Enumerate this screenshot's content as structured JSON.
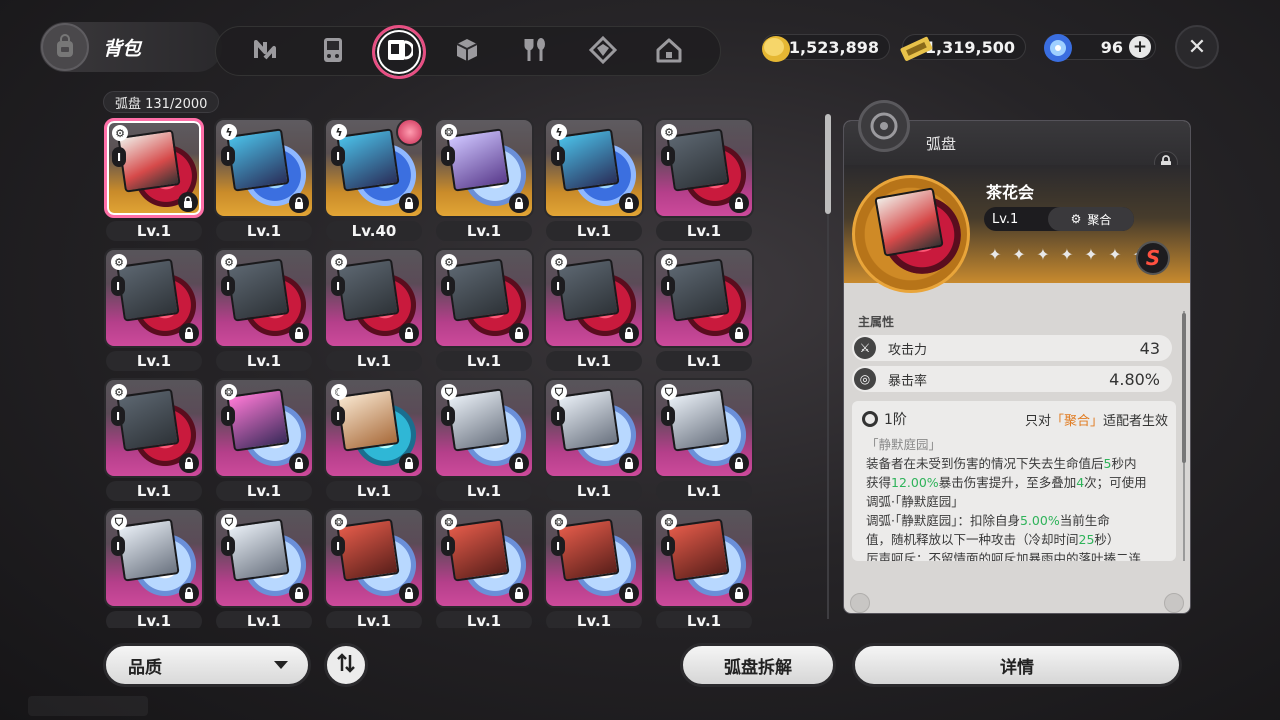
{
  "header": {
    "bag_label": "背包",
    "tabs": [
      {
        "name": "tab-agents",
        "icon": "n-logo-icon"
      },
      {
        "name": "tab-devices",
        "icon": "gameboy-icon"
      },
      {
        "name": "tab-discs",
        "icon": "disc-sleeve-icon",
        "active": true
      },
      {
        "name": "tab-materials",
        "icon": "cube-icon"
      },
      {
        "name": "tab-consumables",
        "icon": "fork-spoon-icon"
      },
      {
        "name": "tab-upgrade",
        "icon": "crystal-icon"
      },
      {
        "name": "tab-home",
        "icon": "house-icon"
      }
    ],
    "currencies": [
      {
        "icon": "gold-coin-icon",
        "value": "1,523,898"
      },
      {
        "icon": "ticket-icon",
        "value": "1,319,500"
      },
      {
        "icon": "energy-orb-icon",
        "value": "96"
      }
    ]
  },
  "inventory": {
    "count_label": "弧盘  131/2000",
    "items": [
      {
        "lv": "Lv.1",
        "type": "gear",
        "rim": "gold",
        "disc": "red",
        "sleeve": "art1",
        "selected": true
      },
      {
        "lv": "Lv.1",
        "type": "bolt",
        "rim": "gold",
        "disc": "blue",
        "sleeve": "art2"
      },
      {
        "lv": "Lv.40",
        "type": "bolt",
        "rim": "gold",
        "disc": "blue",
        "sleeve": "art2",
        "equipped": true
      },
      {
        "lv": "Lv.1",
        "type": "swirl",
        "rim": "gold",
        "disc": "white",
        "sleeve": "art3"
      },
      {
        "lv": "Lv.1",
        "type": "bolt",
        "rim": "gold",
        "disc": "blue",
        "sleeve": "art2"
      },
      {
        "lv": "Lv.1",
        "type": "gear",
        "rim": "pink",
        "disc": "red",
        "sleeve": "dark"
      },
      {
        "lv": "Lv.1",
        "type": "gear",
        "rim": "pink",
        "disc": "red",
        "sleeve": "dark"
      },
      {
        "lv": "Lv.1",
        "type": "gear",
        "rim": "pink",
        "disc": "red",
        "sleeve": "dark"
      },
      {
        "lv": "Lv.1",
        "type": "gear",
        "rim": "pink",
        "disc": "red",
        "sleeve": "dark"
      },
      {
        "lv": "Lv.1",
        "type": "gear",
        "rim": "pink",
        "disc": "red",
        "sleeve": "dark"
      },
      {
        "lv": "Lv.1",
        "type": "gear",
        "rim": "pink",
        "disc": "red",
        "sleeve": "dark"
      },
      {
        "lv": "Lv.1",
        "type": "gear",
        "rim": "pink",
        "disc": "red",
        "sleeve": "dark"
      },
      {
        "lv": "Lv.1",
        "type": "gear",
        "rim": "pink",
        "disc": "red",
        "sleeve": "dark"
      },
      {
        "lv": "Lv.1",
        "type": "swirl",
        "rim": "pink",
        "disc": "white",
        "sleeve": "art7"
      },
      {
        "lv": "Lv.1",
        "type": "moon",
        "rim": "pink",
        "disc": "cyan",
        "sleeve": "art4"
      },
      {
        "lv": "Lv.1",
        "type": "shield",
        "rim": "pink",
        "disc": "white",
        "sleeve": "art5"
      },
      {
        "lv": "Lv.1",
        "type": "shield",
        "rim": "pink",
        "disc": "white",
        "sleeve": "art5"
      },
      {
        "lv": "Lv.1",
        "type": "shield",
        "rim": "pink",
        "disc": "white",
        "sleeve": "art5"
      },
      {
        "lv": "Lv.1",
        "type": "shield",
        "rim": "pink",
        "disc": "white",
        "sleeve": "art5"
      },
      {
        "lv": "Lv.1",
        "type": "shield",
        "rim": "pink",
        "disc": "white",
        "sleeve": "art5"
      },
      {
        "lv": "Lv.1",
        "type": "swirl",
        "rim": "pink",
        "disc": "white",
        "sleeve": "art6"
      },
      {
        "lv": "Lv.1",
        "type": "swirl",
        "rim": "pink",
        "disc": "white",
        "sleeve": "art6"
      },
      {
        "lv": "Lv.1",
        "type": "swirl",
        "rim": "pink",
        "disc": "white",
        "sleeve": "art6"
      },
      {
        "lv": "Lv.1",
        "type": "swirl",
        "rim": "pink",
        "disc": "white",
        "sleeve": "art6"
      }
    ]
  },
  "controls": {
    "filter_label": "品质",
    "dismantle_label": "弧盘拆解",
    "details_label": "详情"
  },
  "detail": {
    "header_title": "弧盘",
    "disc_name": "茶花会",
    "level": "Lv.1",
    "tag": "聚合",
    "rank": "S",
    "stars": 7,
    "main_attr_label": "主属性",
    "attrs": [
      {
        "label": "攻击力",
        "value": "43",
        "icon": "attack-icon"
      },
      {
        "label": "暴击率",
        "value": "4.80%",
        "icon": "crit-icon"
      }
    ],
    "effect": {
      "tier": "1阶",
      "req_prefix": "只对",
      "req_tag": "「聚合」",
      "req_suffix": "适配者生效",
      "title": "「静默庭园」",
      "line1a": "装备者在未受到伤害的情况下失去生命值后",
      "line1b": "5",
      "line1c": "秒内",
      "line2a": "获得",
      "line2b": "12.00%",
      "line2c": "暴击伤害提升，至多叠加",
      "line2d": "4",
      "line2e": "次；可使用",
      "line3": "调弧·「静默庭园」",
      "line4a": "调弧·「静默庭园」：扣除自身",
      "line4b": "5.00%",
      "line4c": "当前生命",
      "line5a": "值，随机释放以下一种攻击（冷却时间",
      "line5b": "25",
      "line5c": "秒）",
      "line6": "厉声呵斥：不留情面的呵斥加暴雨中的落叶揍二连"
    }
  }
}
